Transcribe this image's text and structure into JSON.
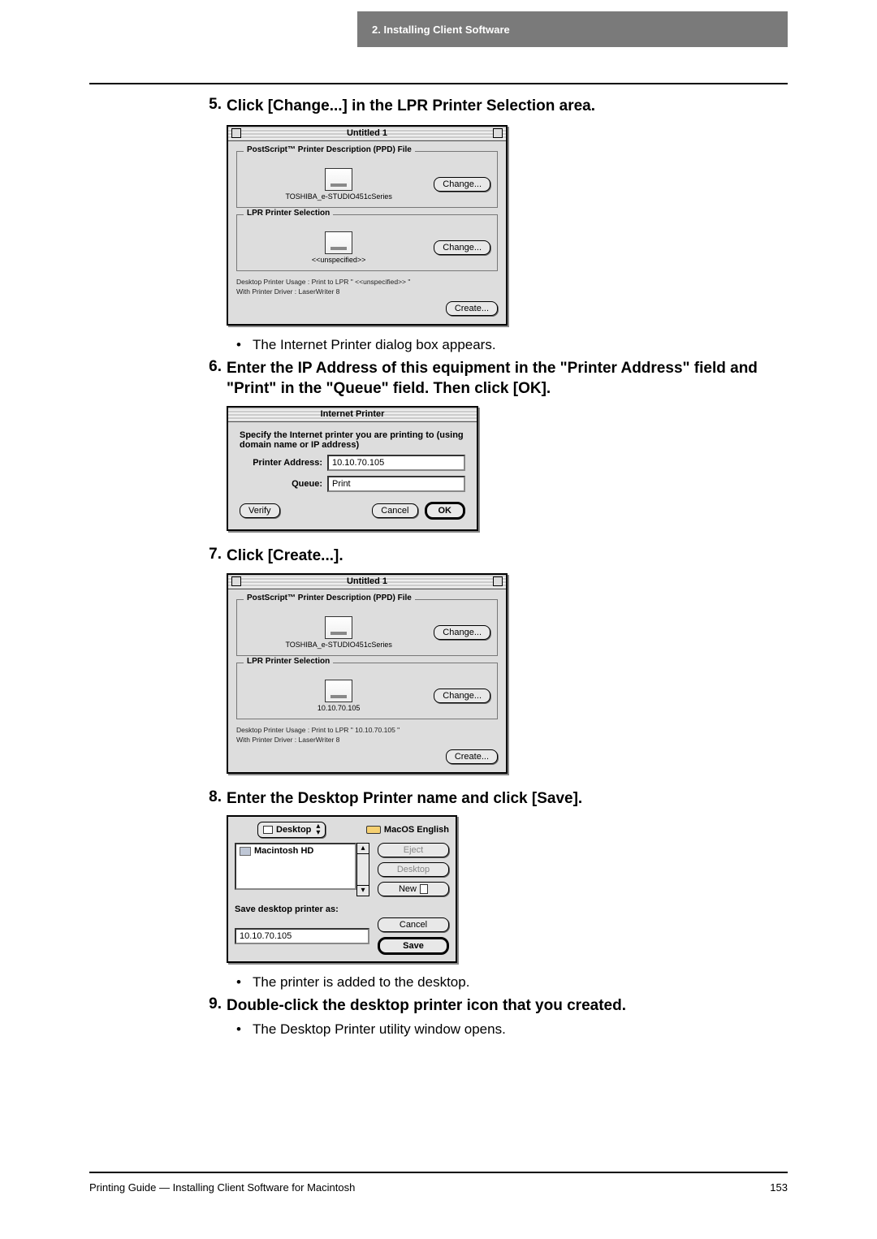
{
  "header": {
    "chapter": "2.  Installing Client Software"
  },
  "steps": {
    "s5": {
      "num": "5.",
      "text": "Click [Change...] in the LPR Printer Selection area.",
      "bullet": "The Internet Printer dialog box appears."
    },
    "s6": {
      "num": "6.",
      "text": "Enter the IP Address of this equipment in the \"Printer Address\" field and \"Print\" in the \"Queue\" field.  Then click [OK]."
    },
    "s7": {
      "num": "7.",
      "text": "Click [Create...]."
    },
    "s8": {
      "num": "8.",
      "text": "Enter the Desktop Printer name and click [Save].",
      "bullet": "The printer is added to the desktop."
    },
    "s9": {
      "num": "9.",
      "text": "Double-click the desktop printer icon that you created.",
      "bullet": "The Desktop Printer utility window opens."
    }
  },
  "dlg1": {
    "title": "Untitled 1",
    "ppd_legend": "PostScript™ Printer Description (PPD) File",
    "ppd_label": "TOSHIBA_e-STUDIO451cSeries",
    "change": "Change...",
    "lpr_legend": "LPR Printer Selection",
    "lpr_label": "<<unspecified>>",
    "usage": "Desktop Printer Usage : Print to LPR  \" <<unspecified>> \"",
    "driver": "With Printer Driver : LaserWriter 8",
    "create": "Create..."
  },
  "ipdlg": {
    "title": "Internet Printer",
    "msg": "Specify the Internet printer you are printing to (using domain name or IP address)",
    "addr_label": "Printer Address:",
    "addr_value": "10.10.70.105",
    "queue_label": "Queue:",
    "queue_value": "Print",
    "verify": "Verify",
    "cancel": "Cancel",
    "ok": "OK"
  },
  "dlg2": {
    "title": "Untitled 1",
    "ppd_legend": "PostScript™ Printer Description (PPD) File",
    "ppd_label": "TOSHIBA_e-STUDIO451cSeries",
    "change": "Change...",
    "lpr_legend": "LPR Printer Selection",
    "lpr_label": "10.10.70.105",
    "usage": "Desktop Printer Usage : Print to LPR  \" 10.10.70.105 \"",
    "driver": "With Printer Driver : LaserWriter 8",
    "create": "Create..."
  },
  "savedlg": {
    "dropdown": "Desktop",
    "volume": "MacOS English",
    "folder": "Macintosh HD",
    "eject": "Eject",
    "desktop": "Desktop",
    "new": "New",
    "prompt": "Save desktop printer as:",
    "name": "10.10.70.105",
    "cancel": "Cancel",
    "save": "Save"
  },
  "footer": {
    "text": "Printing Guide — Installing Client Software for Macintosh",
    "page": "153"
  }
}
